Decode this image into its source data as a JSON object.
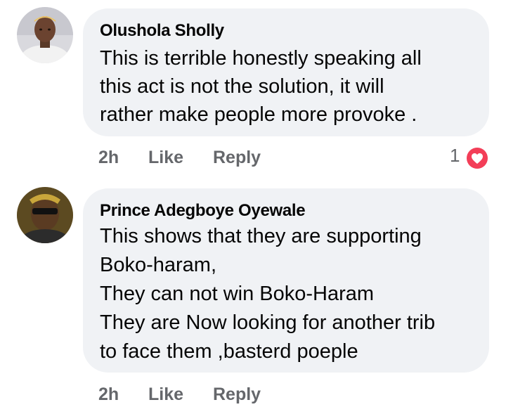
{
  "comments": [
    {
      "author": "Olushola Sholly",
      "lines": [
        "This is terrible honestly speaking all",
        "this act is not the solution, it will",
        "rather make people more provoke ."
      ],
      "time": "2h",
      "like_label": "Like",
      "reply_label": "Reply",
      "reaction_count": "1",
      "reaction_icon": "heart-icon"
    },
    {
      "author": "Prince Adegboye Oyewale",
      "lines": [
        "This shows that they are supporting",
        "Boko-haram,",
        "They can not win Boko-Haram",
        "They are Now looking for another trib",
        "to face them ,basterd poeple"
      ],
      "time": "2h",
      "like_label": "Like",
      "reply_label": "Reply"
    }
  ],
  "colors": {
    "bubble": "#f0f2f5",
    "text": "#050505",
    "secondary": "#65676b",
    "heart": "#f33e58"
  }
}
